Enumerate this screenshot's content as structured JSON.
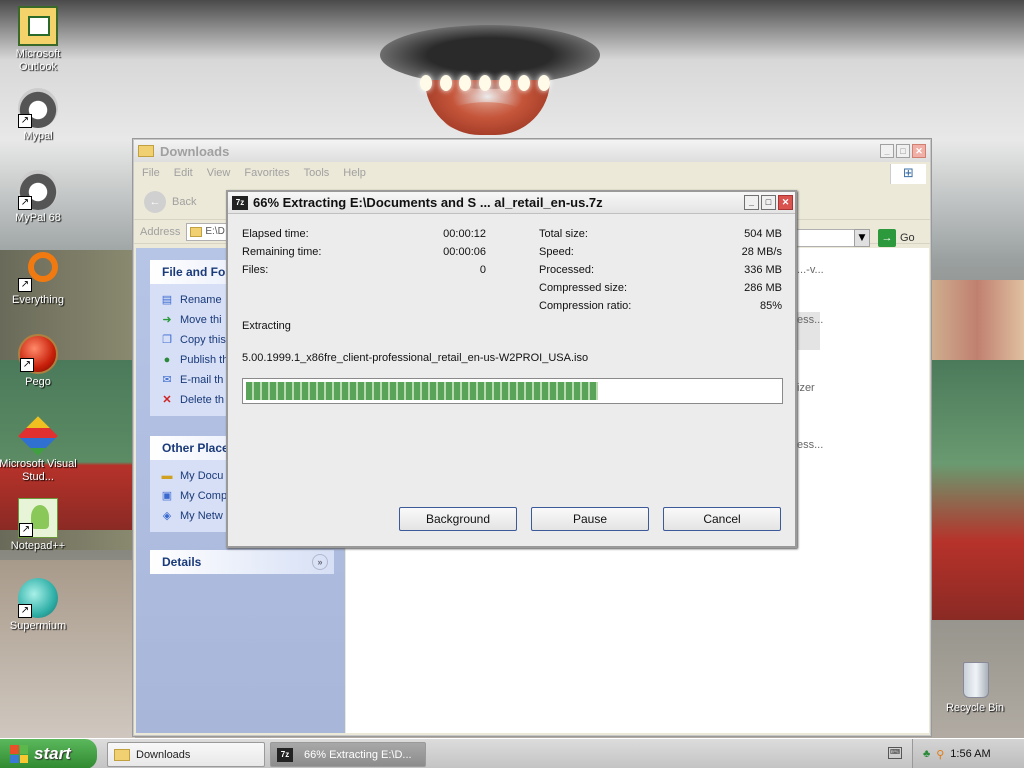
{
  "desktop": {
    "icons": [
      {
        "label": "Microsoft Outlook",
        "icon": "outlook-icon"
      },
      {
        "label": "Mypal",
        "icon": "raccoon-icon"
      },
      {
        "label": "MyPal 68",
        "icon": "raccoon-icon"
      },
      {
        "label": "Everything",
        "icon": "magnifier-ring-icon"
      },
      {
        "label": "Pego",
        "icon": "red-ball-icon"
      },
      {
        "label": "Microsoft Visual Stud...",
        "icon": "visual-studio-icon"
      },
      {
        "label": "Notepad++",
        "icon": "notepad-icon"
      },
      {
        "label": "Supermium",
        "icon": "browser-sphere-icon"
      },
      {
        "label": "Recycle Bin",
        "icon": "recycle-bin-icon"
      }
    ]
  },
  "explorer": {
    "title": "Downloads",
    "menu": [
      "File",
      "Edit",
      "View",
      "Favorites",
      "Tools",
      "Help"
    ],
    "back_label": "Back",
    "address_label": "Address",
    "address_value": "E:\\D",
    "go_label": "Go",
    "tasks_panel": {
      "title": "File and Fold",
      "items": [
        "Rename",
        "Move thi",
        "Copy this",
        "Publish th",
        "E-mail th",
        "Delete th"
      ]
    },
    "places_panel": {
      "title": "Other Place",
      "items": [
        "My Docu",
        "My Comp",
        "My Netw"
      ]
    },
    "details_panel": {
      "title": "Details"
    },
    "ghost_text": [
      "...-v...",
      "ess...",
      "izer",
      "ess..."
    ]
  },
  "dialog": {
    "title": "66% Extracting E:\\Documents and S ... al_retail_en-us.7z",
    "elapsed_label": "Elapsed time:",
    "elapsed_value": "00:00:12",
    "remaining_label": "Remaining time:",
    "remaining_value": "00:00:06",
    "files_label": "Files:",
    "files_value": "0",
    "total_label": "Total size:",
    "total_value": "504 MB",
    "speed_label": "Speed:",
    "speed_value": "28 MB/s",
    "processed_label": "Processed:",
    "processed_value": "336 MB",
    "compressed_label": "Compressed size:",
    "compressed_value": "286 MB",
    "ratio_label": "Compression ratio:",
    "ratio_value": "85%",
    "status": "Extracting",
    "filename": "5.00.1999.1_x86fre_client-professional_retail_en-us-W2PROI_USA.iso",
    "progress_percent": 66,
    "buttons": {
      "background": "Background",
      "pause": "Pause",
      "cancel": "Cancel"
    }
  },
  "taskbar": {
    "start_label": "start",
    "tasks": [
      {
        "label": "Downloads",
        "active": false
      },
      {
        "label": "66% Extracting E:\\D...",
        "active": true
      }
    ],
    "clock": "1:56 AM"
  }
}
